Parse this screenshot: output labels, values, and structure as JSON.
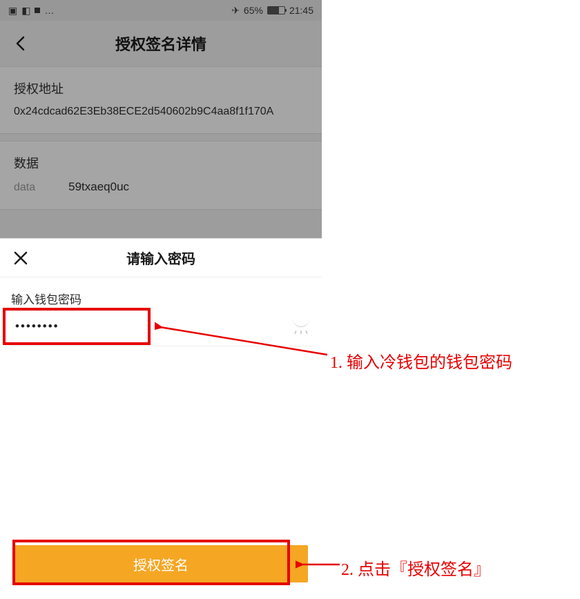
{
  "status": {
    "battery_text": "65%",
    "time": "21:45"
  },
  "nav": {
    "title": "授权签名详情"
  },
  "sections": {
    "auth_address": {
      "label": "授权地址",
      "value": "0x24cdcad62E3Eb38ECE2d540602b9C4aa8f1f170A"
    },
    "data": {
      "label": "数据",
      "key": "data",
      "value": "59txaeq0uc"
    }
  },
  "sheet": {
    "title": "请输入密码",
    "field_label": "输入钱包密码",
    "password_mask": "••••••••",
    "button_label": "授权签名"
  },
  "annotations": {
    "a1": "1. 输入冷钱包的钱包密码",
    "a2": "2. 点击『授权签名』"
  },
  "colors": {
    "accent": "#f5a623",
    "annotation": "#e60000"
  }
}
